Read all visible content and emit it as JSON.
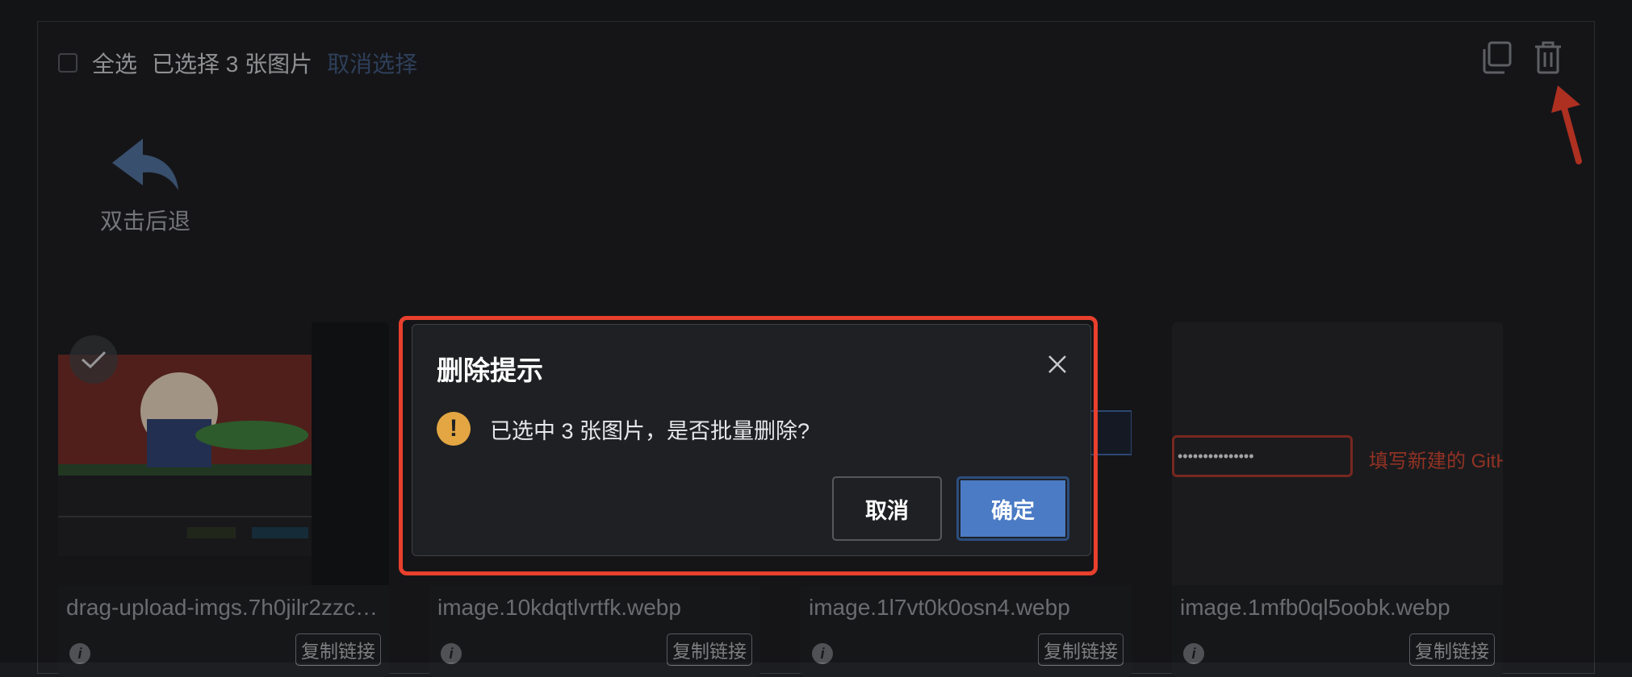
{
  "toolbar": {
    "select_all": "全选",
    "selected_count": "已选择 3 张图片",
    "deselect": "取消选择"
  },
  "back": {
    "label": "双击后退"
  },
  "cards": [
    {
      "filename": "drag-upload-imgs.7h0jilr2zzc…",
      "copy_label": "复制链接",
      "selected": true
    },
    {
      "filename": "image.10kdqtlvrtfk.webp",
      "copy_label": "复制链接",
      "selected": true
    },
    {
      "filename": "image.1l7vt0k0osn4.webp",
      "copy_label": "复制链接",
      "selected": true
    },
    {
      "filename": "image.1mfb0ql5oobk.webp",
      "copy_label": "复制链接",
      "selected": false
    }
  ],
  "card4_preview": {
    "masked": "•••••••••••••••",
    "hint": "填写新建的 GitH"
  },
  "dialog": {
    "title": "删除提示",
    "message": "已选中 3 张图片，是否批量删除?",
    "cancel": "取消",
    "confirm": "确定"
  },
  "colors": {
    "background": "#1a1b1e",
    "link": "#3e5579",
    "primary": "#4a7bc4",
    "warning": "#e3a642",
    "annotation": "#e8402d"
  }
}
